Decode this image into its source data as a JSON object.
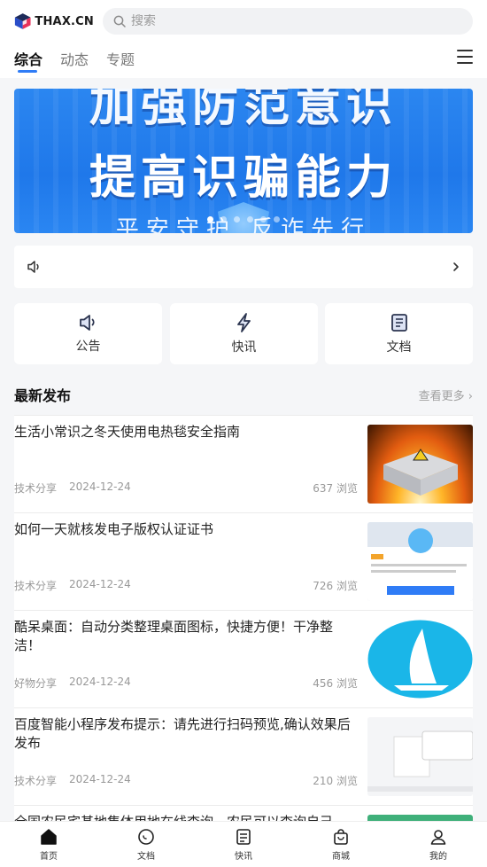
{
  "header": {
    "logo_text": "THAX.CN",
    "search_placeholder": "搜索"
  },
  "tabs": [
    {
      "label": "综合",
      "active": true
    },
    {
      "label": "动态",
      "active": false
    },
    {
      "label": "专题",
      "active": false
    }
  ],
  "banner": {
    "line1": "加强防范意识",
    "line2": "提高识骗能力",
    "line3": "平安守护 反诈先行",
    "slides": 6,
    "active_slide": 0
  },
  "notice": {
    "icon": "speaker-icon",
    "arrow": "chevron-right-icon"
  },
  "quick_tiles": [
    {
      "label": "公告",
      "icon": "announcement-icon"
    },
    {
      "label": "快讯",
      "icon": "lightning-icon"
    },
    {
      "label": "文档",
      "icon": "document-icon"
    }
  ],
  "section": {
    "title": "最新发布",
    "more": "查看更多 ›"
  },
  "articles": [
    {
      "title": "生活小常识之冬天使用电热毯安全指南",
      "category": "技术分享",
      "date": "2024-12-24",
      "views": "637 浏览"
    },
    {
      "title": "如何一天就核发电子版权认证证书",
      "category": "技术分享",
      "date": "2024-12-24",
      "views": "726 浏览"
    },
    {
      "title": "酷呆桌面：自动分类整理桌面图标，快捷方便！干净整洁！",
      "category": "好物分享",
      "date": "2024-12-24",
      "views": "456 浏览"
    },
    {
      "title": "百度智能小程序发布提示：请先进行扫码预览,确认效果后发布",
      "category": "技术分享",
      "date": "2024-12-24",
      "views": "210 浏览"
    },
    {
      "title": "全国农民宅基地集体用地在线查询，农民可以查询自己",
      "category": "",
      "date": "",
      "views": ""
    }
  ],
  "bottom_nav": [
    {
      "label": "首页",
      "icon": "home-icon",
      "active": true
    },
    {
      "label": "文档",
      "icon": "chat-icon",
      "active": false
    },
    {
      "label": "快讯",
      "icon": "news-icon",
      "active": false
    },
    {
      "label": "商城",
      "icon": "shopping-bag-icon",
      "active": false
    },
    {
      "label": "我的",
      "icon": "user-icon",
      "active": false
    }
  ],
  "colors": {
    "accent": "#2f7cf6",
    "banner_blue": "#1f78ea",
    "background": "#f5f6f8"
  }
}
